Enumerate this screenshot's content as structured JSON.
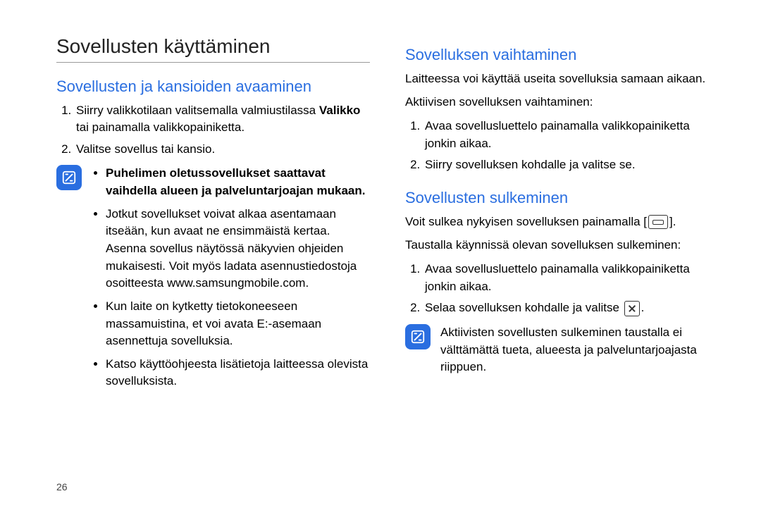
{
  "pageNumber": "26",
  "left": {
    "title": "Sovellusten käyttäminen",
    "h2": "Sovellusten ja kansioiden avaaminen",
    "ol": {
      "i1a": "Siirry valikkotilaan valitsemalla valmiustilassa ",
      "i1b": "Valikko",
      "i1c": " tai painamalla valikkopainiketta.",
      "i2": "Valitse sovellus tai kansio."
    },
    "note": {
      "b1": "Puhelimen oletussovellukset saattavat vaihdella alueen ja palveluntarjoajan mukaan.",
      "b2": "Jotkut sovellukset voivat alkaa asentamaan itseään, kun avaat ne ensimmäistä kertaa. Asenna sovellus näytössä näkyvien ohjeiden mukaisesti. Voit myös ladata asennustiedostoja osoitteesta www.samsungmobile.com.",
      "b3": "Kun laite on kytketty tietokoneeseen massamuistina, et voi avata E:-asemaan asennettuja sovelluksia.",
      "b4": "Katso käyttöohjeesta lisätietoja laitteessa olevista sovelluksista."
    }
  },
  "right": {
    "h2a": "Sovelluksen vaihtaminen",
    "p1": "Laitteessa voi käyttää useita sovelluksia samaan aikaan.",
    "p2": "Aktiivisen sovelluksen vaihtaminen:",
    "olA": {
      "i1": "Avaa sovellusluettelo painamalla valikkopainiketta jonkin aikaa.",
      "i2": "Siirry sovelluksen kohdalle ja valitse se."
    },
    "h2b": "Sovellusten sulkeminen",
    "p3a": "Voit sulkea nykyisen sovelluksen painamalla [",
    "p3b": "].",
    "p4": "Taustalla käynnissä olevan sovelluksen sulkeminen:",
    "olB": {
      "i1": "Avaa sovellusluettelo painamalla valikkopainiketta jonkin aikaa.",
      "i2a": "Selaa sovelluksen kohdalle ja valitse ",
      "i2b": "."
    },
    "note2": "Aktiivisten sovellusten sulkeminen taustalla ei välttämättä tueta, alueesta ja palveluntarjoajasta riippuen."
  }
}
